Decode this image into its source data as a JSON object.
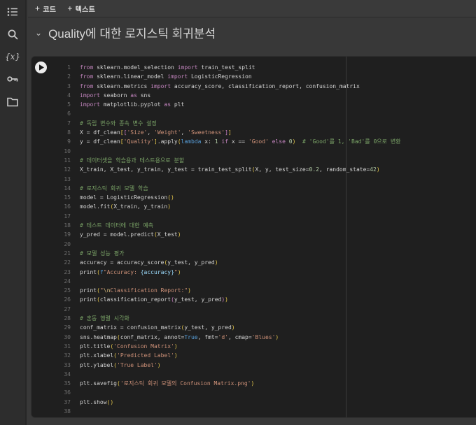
{
  "colors": {
    "page_bg": "#383838",
    "editor_bg": "#1f1f1f",
    "keyword": "#c586c0",
    "keyword_blue": "#569cd6",
    "string": "#ce9178",
    "comment": "#7ca668",
    "number": "#b5cea8"
  },
  "sidebar": {
    "icons": [
      {
        "name": "table-of-contents-icon"
      },
      {
        "name": "search-icon"
      },
      {
        "name": "variables-icon",
        "label": "{x}"
      },
      {
        "name": "key-icon"
      },
      {
        "name": "folder-icon"
      }
    ]
  },
  "toolbar": {
    "buttons": [
      {
        "icon": "+",
        "label": "코드"
      },
      {
        "icon": "+",
        "label": "텍스트"
      }
    ]
  },
  "section": {
    "collapse_glyph": "⌄",
    "title": "Quality에 대한 로지스틱 회귀분석"
  },
  "cell": {
    "run_icon": "play",
    "lines": [
      {
        "n": 1,
        "t": [
          [
            "kw",
            "from"
          ],
          [
            "pl",
            " sklearn.model_selection "
          ],
          [
            "kw",
            "import"
          ],
          [
            "pl",
            " train_test_split"
          ]
        ]
      },
      {
        "n": 2,
        "t": [
          [
            "kw",
            "from"
          ],
          [
            "pl",
            " sklearn.linear_model "
          ],
          [
            "kw",
            "import"
          ],
          [
            "pl",
            " LogisticRegression"
          ]
        ]
      },
      {
        "n": 3,
        "t": [
          [
            "kw",
            "from"
          ],
          [
            "pl",
            " sklearn.metrics "
          ],
          [
            "kw",
            "import"
          ],
          [
            "pl",
            " accuracy_score, classification_report, confusion_matrix"
          ]
        ]
      },
      {
        "n": 4,
        "t": [
          [
            "kw",
            "import"
          ],
          [
            "pl",
            " seaborn "
          ],
          [
            "kw",
            "as"
          ],
          [
            "pl",
            " sns"
          ]
        ]
      },
      {
        "n": 5,
        "t": [
          [
            "kw",
            "import"
          ],
          [
            "pl",
            " matplotlib.pyplot "
          ],
          [
            "kw",
            "as"
          ],
          [
            "pl",
            " plt"
          ]
        ]
      },
      {
        "n": 6,
        "t": []
      },
      {
        "n": 7,
        "t": [
          [
            "com",
            "# 독립 변수와 종속 변수 설정"
          ]
        ]
      },
      {
        "n": 8,
        "t": [
          [
            "pl",
            "X = df_clean"
          ],
          [
            "b1",
            "["
          ],
          [
            "b2",
            "["
          ],
          [
            "str",
            "'Size'"
          ],
          [
            "pl",
            ", "
          ],
          [
            "str",
            "'Weight'"
          ],
          [
            "pl",
            ", "
          ],
          [
            "str",
            "'Sweetness'"
          ],
          [
            "b2",
            "]"
          ],
          [
            "b1",
            "]"
          ]
        ]
      },
      {
        "n": 9,
        "t": [
          [
            "pl",
            "y = df_clean"
          ],
          [
            "b1",
            "["
          ],
          [
            "str",
            "'Quality'"
          ],
          [
            "b1",
            "]"
          ],
          [
            "pl",
            ".apply"
          ],
          [
            "b1",
            "("
          ],
          [
            "kw2",
            "lambda"
          ],
          [
            "pl",
            " x: "
          ],
          [
            "num",
            "1"
          ],
          [
            "pl",
            " "
          ],
          [
            "kw",
            "if"
          ],
          [
            "pl",
            " x == "
          ],
          [
            "str",
            "'Good'"
          ],
          [
            "pl",
            " "
          ],
          [
            "kw",
            "else"
          ],
          [
            "pl",
            " "
          ],
          [
            "num",
            "0"
          ],
          [
            "b1",
            ")"
          ],
          [
            "pl",
            "  "
          ],
          [
            "com",
            "# 'Good'를 1, 'Bad'를 0으로 변환"
          ]
        ]
      },
      {
        "n": 10,
        "t": []
      },
      {
        "n": 11,
        "t": [
          [
            "com",
            "# 데이터셋을 학습용과 테스트용으로 분할"
          ]
        ]
      },
      {
        "n": 12,
        "t": [
          [
            "pl",
            "X_train, X_test, y_train, y_test = train_test_split"
          ],
          [
            "b1",
            "("
          ],
          [
            "pl",
            "X, y, test_size="
          ],
          [
            "num",
            "0.2"
          ],
          [
            "pl",
            ", random_state="
          ],
          [
            "num",
            "42"
          ],
          [
            "b1",
            ")"
          ]
        ]
      },
      {
        "n": 13,
        "t": []
      },
      {
        "n": 14,
        "t": [
          [
            "com",
            "# 로지스틱 회귀 모델 학습"
          ]
        ]
      },
      {
        "n": 15,
        "t": [
          [
            "pl",
            "model = LogisticRegression"
          ],
          [
            "b1",
            "()"
          ]
        ]
      },
      {
        "n": 16,
        "t": [
          [
            "pl",
            "model.fit"
          ],
          [
            "b1",
            "("
          ],
          [
            "pl",
            "X_train, y_train"
          ],
          [
            "b1",
            ")"
          ]
        ]
      },
      {
        "n": 17,
        "t": []
      },
      {
        "n": 18,
        "t": [
          [
            "com",
            "# 테스트 데이터에 대한 예측"
          ]
        ]
      },
      {
        "n": 19,
        "t": [
          [
            "pl",
            "y_pred = model.predict"
          ],
          [
            "b1",
            "("
          ],
          [
            "pl",
            "X_test"
          ],
          [
            "b1",
            ")"
          ]
        ]
      },
      {
        "n": 20,
        "t": []
      },
      {
        "n": 21,
        "t": [
          [
            "com",
            "# 모델 성능 평가"
          ]
        ]
      },
      {
        "n": 22,
        "t": [
          [
            "pl",
            "accuracy = accuracy_score"
          ],
          [
            "b1",
            "("
          ],
          [
            "pl",
            "y_test, y_pred"
          ],
          [
            "b1",
            ")"
          ]
        ]
      },
      {
        "n": 23,
        "t": [
          [
            "pl",
            "print"
          ],
          [
            "b1",
            "("
          ],
          [
            "kw2",
            "f"
          ],
          [
            "str",
            "\"Accuracy: "
          ],
          [
            "ip",
            "{accuracy}"
          ],
          [
            "str",
            "\""
          ],
          [
            "b1",
            ")"
          ]
        ]
      },
      {
        "n": 24,
        "t": []
      },
      {
        "n": 25,
        "t": [
          [
            "pl",
            "print"
          ],
          [
            "b1",
            "("
          ],
          [
            "str",
            "\""
          ],
          [
            "esc",
            "\\n"
          ],
          [
            "str",
            "Classification Report:\""
          ],
          [
            "b1",
            ")"
          ]
        ]
      },
      {
        "n": 26,
        "t": [
          [
            "pl",
            "print"
          ],
          [
            "b1",
            "("
          ],
          [
            "pl",
            "classification_report"
          ],
          [
            "b2",
            "("
          ],
          [
            "pl",
            "y_test, y_pred"
          ],
          [
            "b2",
            ")"
          ],
          [
            "b1",
            ")"
          ]
        ]
      },
      {
        "n": 27,
        "t": []
      },
      {
        "n": 28,
        "t": [
          [
            "com",
            "# 혼동 행렬 시각화"
          ]
        ]
      },
      {
        "n": 29,
        "t": [
          [
            "pl",
            "conf_matrix = confusion_matrix"
          ],
          [
            "b1",
            "("
          ],
          [
            "pl",
            "y_test, y_pred"
          ],
          [
            "b1",
            ")"
          ]
        ]
      },
      {
        "n": 30,
        "t": [
          [
            "pl",
            "sns.heatmap"
          ],
          [
            "b1",
            "("
          ],
          [
            "pl",
            "conf_matrix, annot="
          ],
          [
            "kw2",
            "True"
          ],
          [
            "pl",
            ", fmt="
          ],
          [
            "str",
            "'d'"
          ],
          [
            "pl",
            ", cmap="
          ],
          [
            "str",
            "'Blues'"
          ],
          [
            "b1",
            ")"
          ]
        ]
      },
      {
        "n": 31,
        "t": [
          [
            "pl",
            "plt.title"
          ],
          [
            "b1",
            "("
          ],
          [
            "str",
            "'Confusion Matrix'"
          ],
          [
            "b1",
            ")"
          ]
        ]
      },
      {
        "n": 32,
        "t": [
          [
            "pl",
            "plt.xlabel"
          ],
          [
            "b1",
            "("
          ],
          [
            "str",
            "'Predicted Label'"
          ],
          [
            "b1",
            ")"
          ]
        ]
      },
      {
        "n": 33,
        "t": [
          [
            "pl",
            "plt.ylabel"
          ],
          [
            "b1",
            "("
          ],
          [
            "str",
            "'True Label'"
          ],
          [
            "b1",
            ")"
          ]
        ]
      },
      {
        "n": 34,
        "t": []
      },
      {
        "n": 35,
        "t": [
          [
            "pl",
            "plt.savefig"
          ],
          [
            "b1",
            "("
          ],
          [
            "str",
            "'로지스틱 회귀 모델의 Confusion Matrix.png'"
          ],
          [
            "b1",
            ")"
          ]
        ]
      },
      {
        "n": 36,
        "t": []
      },
      {
        "n": 37,
        "t": [
          [
            "pl",
            "plt.show"
          ],
          [
            "b1",
            "()"
          ]
        ]
      },
      {
        "n": 38,
        "t": []
      }
    ]
  }
}
